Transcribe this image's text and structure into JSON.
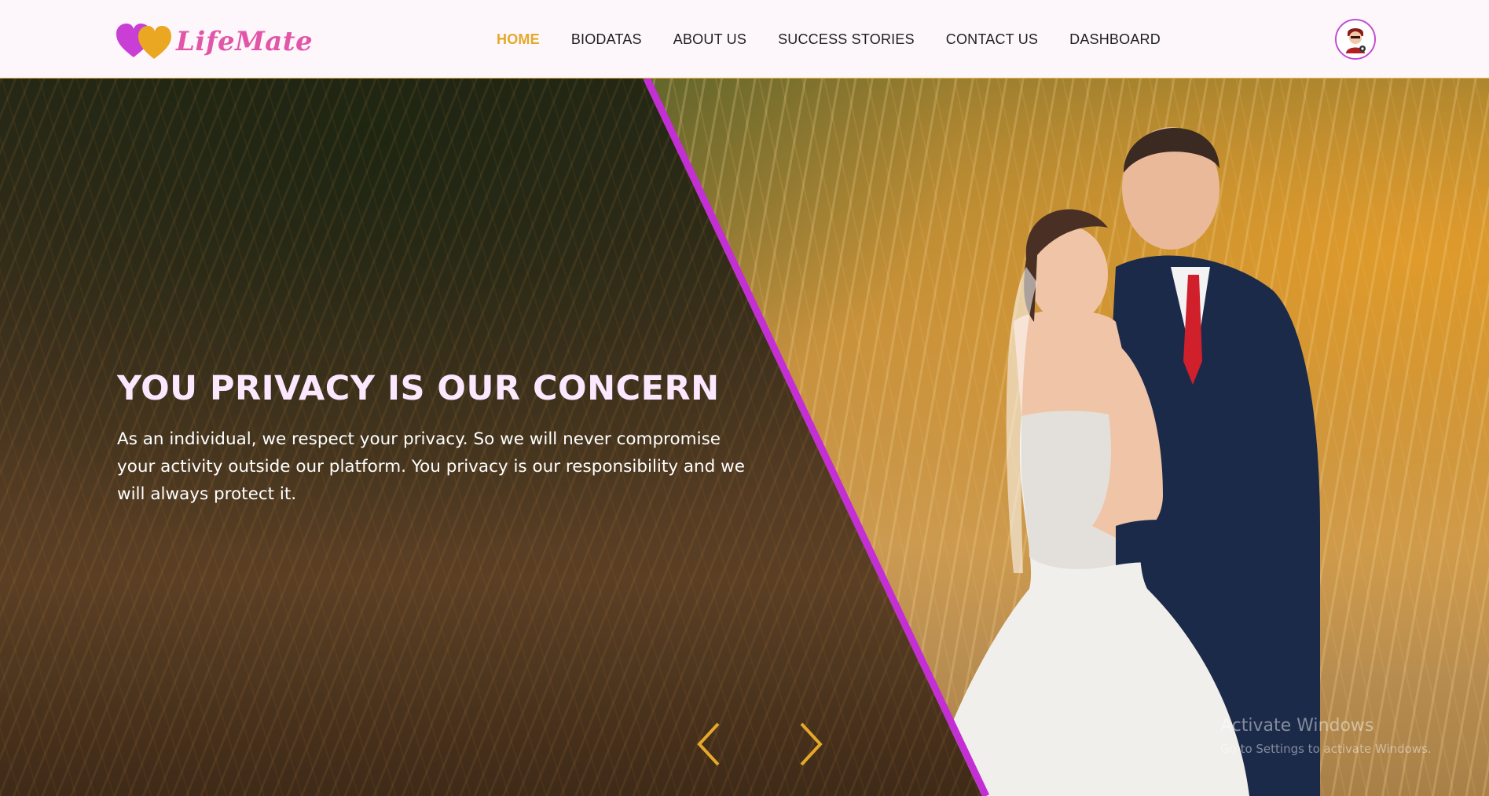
{
  "brand": {
    "name": "LifeMate",
    "colors": {
      "pink": "#e256a8",
      "gold": "#e4a92a",
      "purple": "#c54ad3"
    },
    "icon": "two-hearts-icon"
  },
  "nav": {
    "items": [
      {
        "label": "HOME",
        "active": true
      },
      {
        "label": "BIODATAS",
        "active": false
      },
      {
        "label": "ABOUT US",
        "active": false
      },
      {
        "label": "SUCCESS STORIES",
        "active": false
      },
      {
        "label": "CONTACT US",
        "active": false
      },
      {
        "label": "DASHBOARD",
        "active": false
      }
    ]
  },
  "user": {
    "icon": "user-avatar-icon"
  },
  "hero": {
    "title": "YOU PRIVACY IS OUR CONCERN",
    "text": "As an individual, we respect your privacy. So we will never compromise your activity outside our platform. You privacy is our responsibility and we will always protect it.",
    "prev_icon": "chevron-left-icon",
    "next_icon": "chevron-right-icon"
  },
  "watermark": {
    "line1": "Activate Windows",
    "line2": "Go to Settings to activate Windows."
  }
}
